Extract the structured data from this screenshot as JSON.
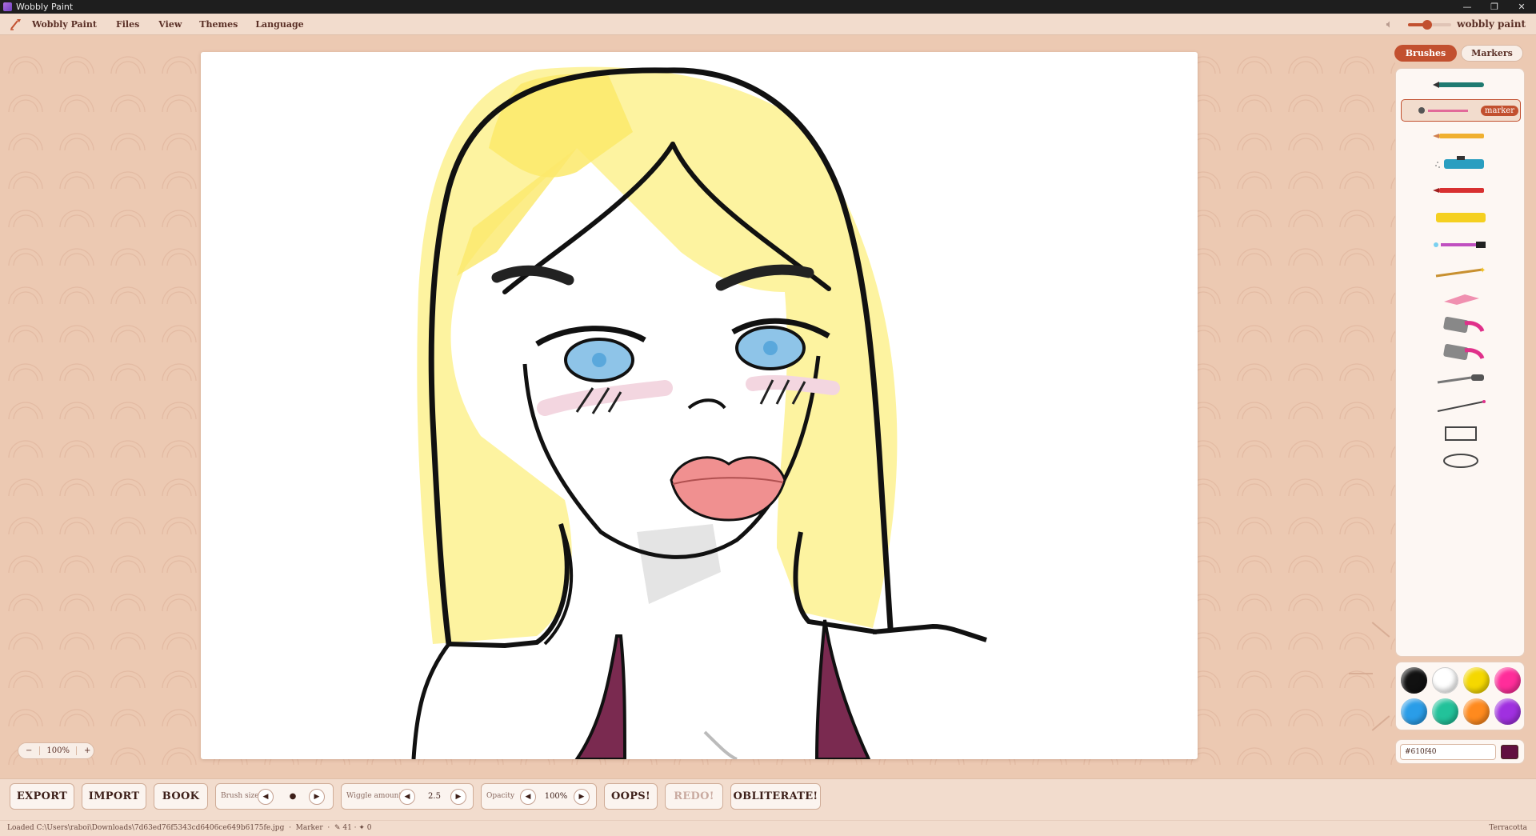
{
  "window": {
    "title": "Wobbly Paint"
  },
  "menu": {
    "items": [
      "Wobbly Paint",
      "Files",
      "View",
      "Themes",
      "Language"
    ],
    "brand": "wobbly paint",
    "volume": 0.45
  },
  "tabs": {
    "brushes": "Brushes",
    "markers": "Markers"
  },
  "tools": {
    "selected_tip": "marker"
  },
  "palette": {
    "colors": [
      "#111111",
      "#ffffff",
      "#f5d800",
      "#ff2d9a",
      "#2a9de8",
      "#22c29a",
      "#ff8a1e",
      "#a030e0"
    ]
  },
  "hex": {
    "value": "#610f40",
    "current_color": "#610f40"
  },
  "zoom": {
    "minus": "−",
    "value": "100%",
    "plus": "+"
  },
  "toolbar": {
    "export": "EXPORT",
    "import": "IMPORT",
    "book": "BOOK",
    "brush_size_label": "Brush size",
    "brush_size_value": "●",
    "wiggle_label": "Wiggle amount",
    "wiggle_value": "2.5",
    "opacity_label": "Opacity",
    "opacity_value": "100%",
    "oops": "OOPS!",
    "redo": "REDO!",
    "obliterate": "OBLITERATE!"
  },
  "status": {
    "loaded": "Loaded C:\\Users\\raboi\\Downloads\\7d63ed76f5343cd6406ce649b6175fe.jpg",
    "tool": "Marker",
    "counts": "✎ 41 · ✦ 0",
    "theme": "Terracotta"
  }
}
